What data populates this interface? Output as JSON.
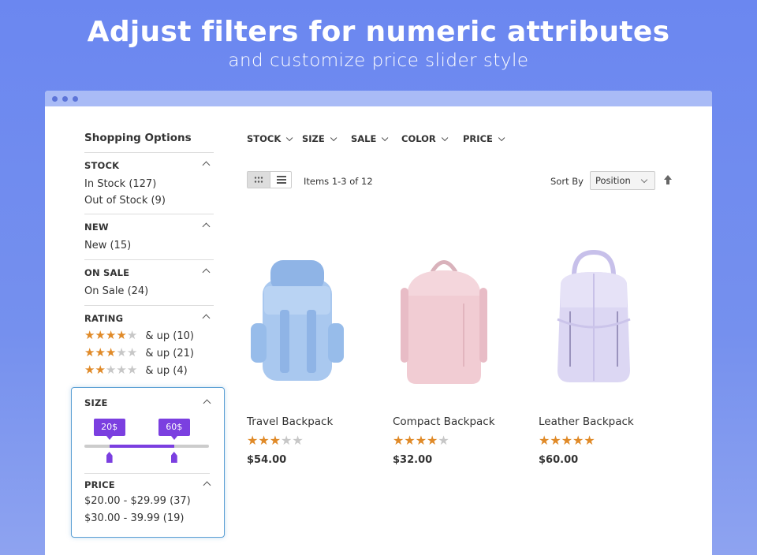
{
  "hero": {
    "title": "Adjust filters for numeric attributes",
    "subtitle": "and customize price slider style"
  },
  "sidebar": {
    "title": "Shopping Options",
    "stock": {
      "heading": "STOCK",
      "options": [
        "In Stock (127)",
        "Out of Stock (9)"
      ]
    },
    "new": {
      "heading": "NEW",
      "options": [
        "New (15)"
      ]
    },
    "on_sale": {
      "heading": "ON SALE",
      "options": [
        "On Sale (24)"
      ]
    },
    "rating": {
      "heading": "RATING",
      "options": [
        {
          "stars": 4,
          "label": "& up (10)"
        },
        {
          "stars": 3,
          "label": "& up (21)"
        },
        {
          "stars": 2,
          "label": "& up (4)"
        }
      ]
    },
    "size": {
      "heading": "SIZE",
      "min_label": "20$",
      "max_label": "60$",
      "min_fraction": 0.2,
      "max_fraction": 0.72
    },
    "price": {
      "heading": "PRICE",
      "options": [
        "$20.00 - $29.99 (37)",
        "$30.00 - 39.99 (19)"
      ]
    }
  },
  "filterbar": [
    "STOCK",
    "SIZE",
    "SALE",
    "COLOR",
    "PRICE"
  ],
  "toolbar": {
    "items_count": "Items 1-3 of 12",
    "sort_label": "Sort By",
    "sort_value": "Position"
  },
  "products": [
    {
      "name": "Travel Backpack",
      "rating": 3,
      "price": "$54.00",
      "color": "#a9c8ef"
    },
    {
      "name": "Compact Backpack",
      "rating": 4,
      "price": "$32.00",
      "color": "#f1ccd3"
    },
    {
      "name": "Leather Backpack",
      "rating": 5,
      "price": "$60.00",
      "color": "#dcd7f3"
    }
  ],
  "colors": {
    "accent": "#7b3fe0",
    "star": "#e08a28",
    "highlight_border": "#5a9fd4"
  }
}
